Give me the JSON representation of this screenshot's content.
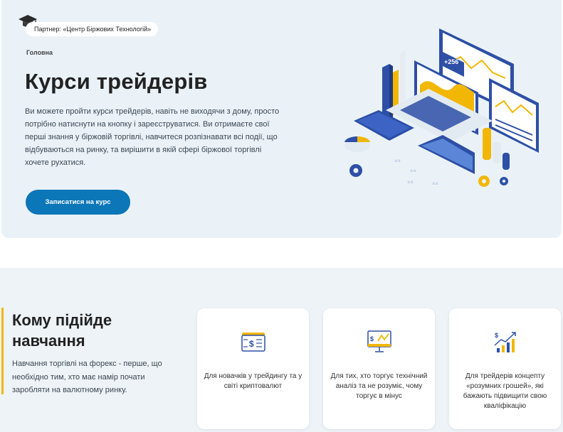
{
  "hero": {
    "partner_label": "Партнер: «Центр Біржових Технологій»",
    "breadcrumb": "Головна",
    "title": "Курси трейдерів",
    "description": "Ви можете пройти курси трейдерів, навіть не виходячи з дому, просто потрібно натиснути на кнопку і зареєструватися. Ви отримаєте свої перші знання у біржовій торгівлі, навчитеся розпізнавати всі події, що відбуваються на ринку, та вирішити в якій сфері біржової торгівлі хочете рухатися.",
    "cta_label": "Записатися на курс",
    "illustration_labels": {
      "price_tag": "+256"
    }
  },
  "who": {
    "title": "Кому підійде навчання",
    "description": "Навчання торгівлі на форекс - перше, що необхідно тим, хто має намір почати заробляти на валютному ринку.",
    "cards": [
      {
        "icon": "money-stack-icon",
        "text": "Для новачків у трейдингу та у світі криптовалют"
      },
      {
        "icon": "chart-monitor-icon",
        "text": "Для тих, хто торгує технічний аналіз та не розуміє, чому торгує в мінус"
      },
      {
        "icon": "growth-chart-icon",
        "text": "Для трейдерів концепту «розумних грошей», які бажають підвищити свою кваліфікацію"
      }
    ]
  },
  "colors": {
    "hero_bg": "#eaf2f8",
    "accent_blue": "#0b76b8",
    "accent_yellow": "#f2b705",
    "dark_blue": "#2d4fa6"
  }
}
